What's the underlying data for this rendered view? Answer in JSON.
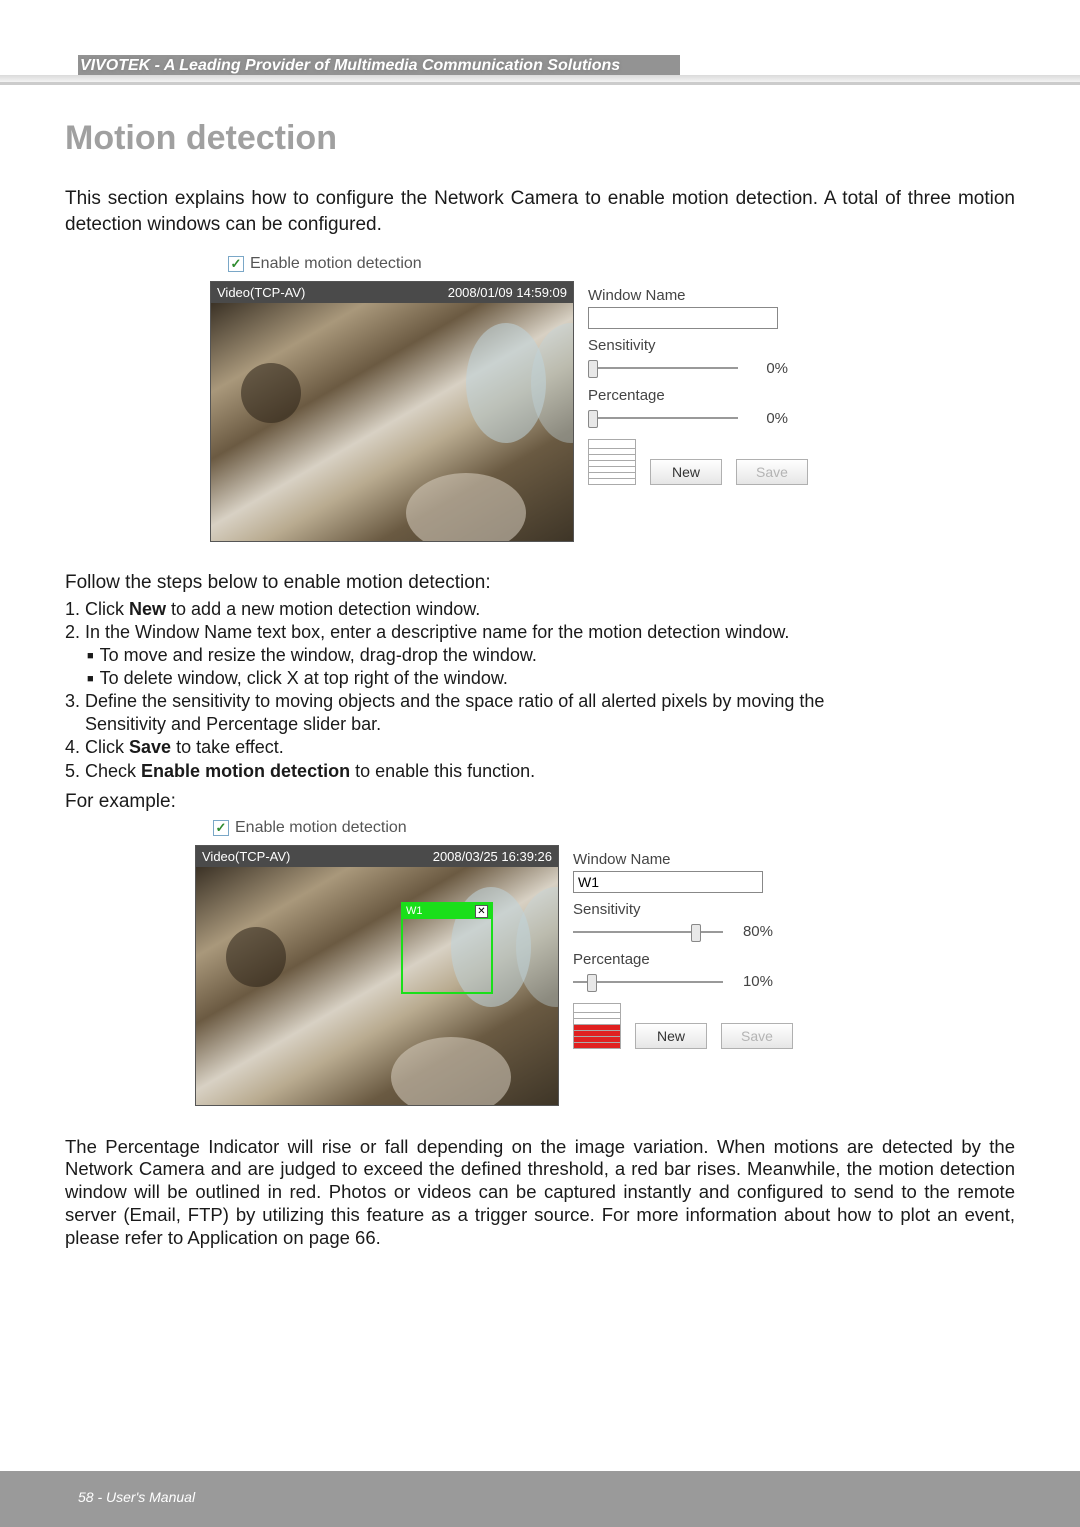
{
  "header": {
    "banner": "VIVOTEK - A Leading Provider of Multimedia Communication Solutions"
  },
  "title": "Motion detection",
  "intro": "This section explains how to configure the Network Camera to enable motion detection. A total of three motion detection windows can be configured.",
  "checkbox_label": "Enable motion detection",
  "panel1": {
    "video_label": "Video(TCP-AV)",
    "timestamp": "2008/01/09 14:59:09",
    "window_name_label": "Window Name",
    "window_name_value": "",
    "sensitivity_label": "Sensitivity",
    "sensitivity_value": "0%",
    "percentage_label": "Percentage",
    "percentage_value": "0%",
    "new_btn": "New",
    "save_btn": "Save"
  },
  "steps_intro": "Follow the steps below to enable motion detection:",
  "steps": {
    "s1a": "1. Click ",
    "s1b": "New",
    "s1c": " to add a new motion detection window.",
    "s2": "2. In the Window Name text box, enter a descriptive name for the motion detection window.",
    "s2a": "To move and resize the window, drag-drop the window.",
    "s2b": "To delete window, click X at top right of the window.",
    "s3": "3. Define the sensitivity to moving objects and the space ratio of all alerted pixels by moving the",
    "s3b": "    Sensitivity and Percentage slider bar.",
    "s4a": "4. Click ",
    "s4b": "Save",
    "s4c": " to take effect.",
    "s5a": "5. Check ",
    "s5b": "Enable motion detection",
    "s5c": " to enable this function."
  },
  "example_label": "For example:",
  "panel2": {
    "video_label": "Video(TCP-AV)",
    "timestamp": "2008/03/25 16:39:26",
    "motion_window_name": "W1",
    "window_name_label": "Window Name",
    "window_name_value": "W1",
    "sensitivity_label": "Sensitivity",
    "sensitivity_value": "80%",
    "percentage_label": "Percentage",
    "percentage_value": "10%",
    "new_btn": "New",
    "save_btn": "Save"
  },
  "outro": "The Percentage Indicator will rise or fall depending on the image variation. When motions are detected by the Network Camera and are judged to exceed the defined threshold, a red bar rises. Meanwhile, the motion detection window will be outlined in red. Photos or videos can be captured instantly and configured to send to the remote server (Email, FTP) by utilizing this feature as a trigger source. For more information about how to plot an event, please refer to Application on page 66.",
  "footer": "58 - User's Manual"
}
